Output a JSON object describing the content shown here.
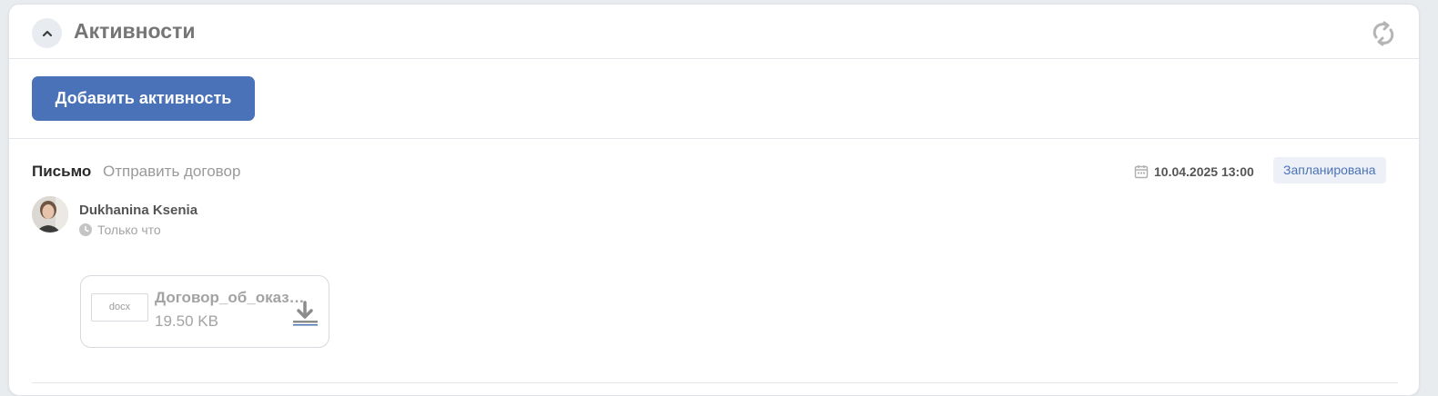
{
  "header": {
    "title": "Активности"
  },
  "toolbar": {
    "add_label": "Добавить активность"
  },
  "activity": {
    "type": "Письмо",
    "subject": "Отправить договор",
    "date": "10.04.2025 13:00",
    "status": "Запланирована",
    "author": "Dukhanina Ksenia",
    "time_ago": "Только что",
    "attachment": {
      "extension": "docx",
      "name": "Договор_об_оказании_услуг",
      "size": "19.50 KB"
    }
  },
  "colors": {
    "accent": "#4a72b8",
    "badge_bg": "#edf1f7",
    "muted_text": "#a3a3a3"
  },
  "icons": {
    "collapse": "chevron-up-icon",
    "refresh": "refresh-icon",
    "date": "calendar-icon",
    "time": "clock-icon",
    "download": "download-icon"
  }
}
